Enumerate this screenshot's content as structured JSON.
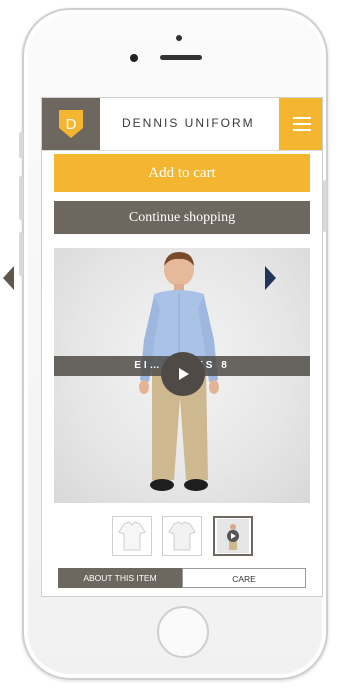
{
  "header": {
    "logo_letter": "D",
    "brand": "DENNIS UNIFORM"
  },
  "actions": {
    "add_to_cart": "Add to cart",
    "continue_shopping": "Continue shopping"
  },
  "product": {
    "caption": "EI… F… YS 8"
  },
  "tabs": [
    {
      "label": "ABOUT THIS ITEM",
      "active": true
    },
    {
      "label": "CARE",
      "active": false
    }
  ],
  "colors": {
    "accent_yellow": "#f4b630",
    "taupe": "#6e6760",
    "navy_arrow": "#21355a"
  },
  "icons": [
    "hamburger-menu-icon",
    "play-icon",
    "chevron-left-icon",
    "chevron-right-icon",
    "shield-logo-icon"
  ]
}
